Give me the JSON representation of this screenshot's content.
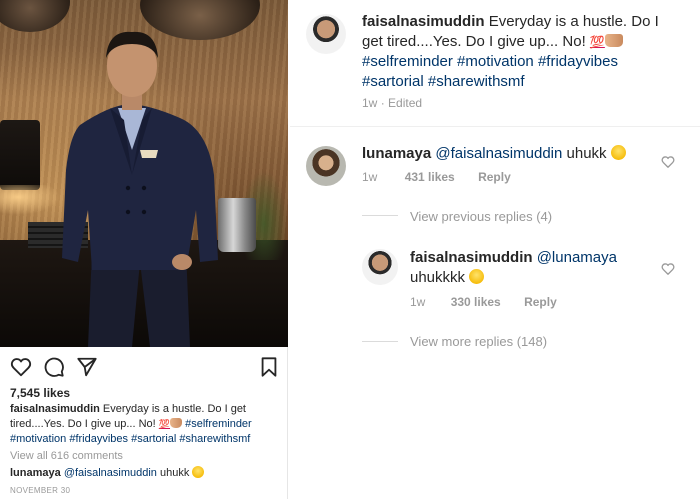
{
  "post": {
    "username": "faisalnasimuddin",
    "caption_text": "Everyday is a hustle. Do I get tired....Yes. Do I give up... No!",
    "hundred_emoji": "💯",
    "hashtags": [
      "#selfreminder",
      "#motivation",
      "#fridayvibes",
      "#sartorial",
      "#sharewithsmf"
    ],
    "time": "1w",
    "edited": "Edited",
    "likes": "7,545 likes",
    "view_all_comments": "View all 616 comments",
    "date": "NOVEMBER 30"
  },
  "feed_comment": {
    "username": "lunamaya",
    "mention": "@faisalnasimuddin",
    "text": "uhukk"
  },
  "comments": [
    {
      "username": "lunamaya",
      "mention": "@faisalnasimuddin",
      "text": "uhukk",
      "time": "1w",
      "likes": "431 likes",
      "reply": "Reply",
      "view_previous": "View previous replies (4)"
    },
    {
      "username": "faisalnasimuddin",
      "mention": "@lunamaya",
      "text": "uhukkkk",
      "time": "1w",
      "likes": "330 likes",
      "reply": "Reply",
      "view_more": "View more replies (148)"
    }
  ],
  "icons": {
    "heart": "heart-icon",
    "comment": "comment-icon",
    "share": "share-icon",
    "save": "bookmark-icon",
    "smile": "smile-emoji",
    "wink": "wink-tongue-emoji",
    "hands": "raised-hands-emoji"
  },
  "colors": {
    "text": "#262626",
    "muted": "#999999",
    "hashtag": "#003569",
    "divider": "#efefef"
  }
}
